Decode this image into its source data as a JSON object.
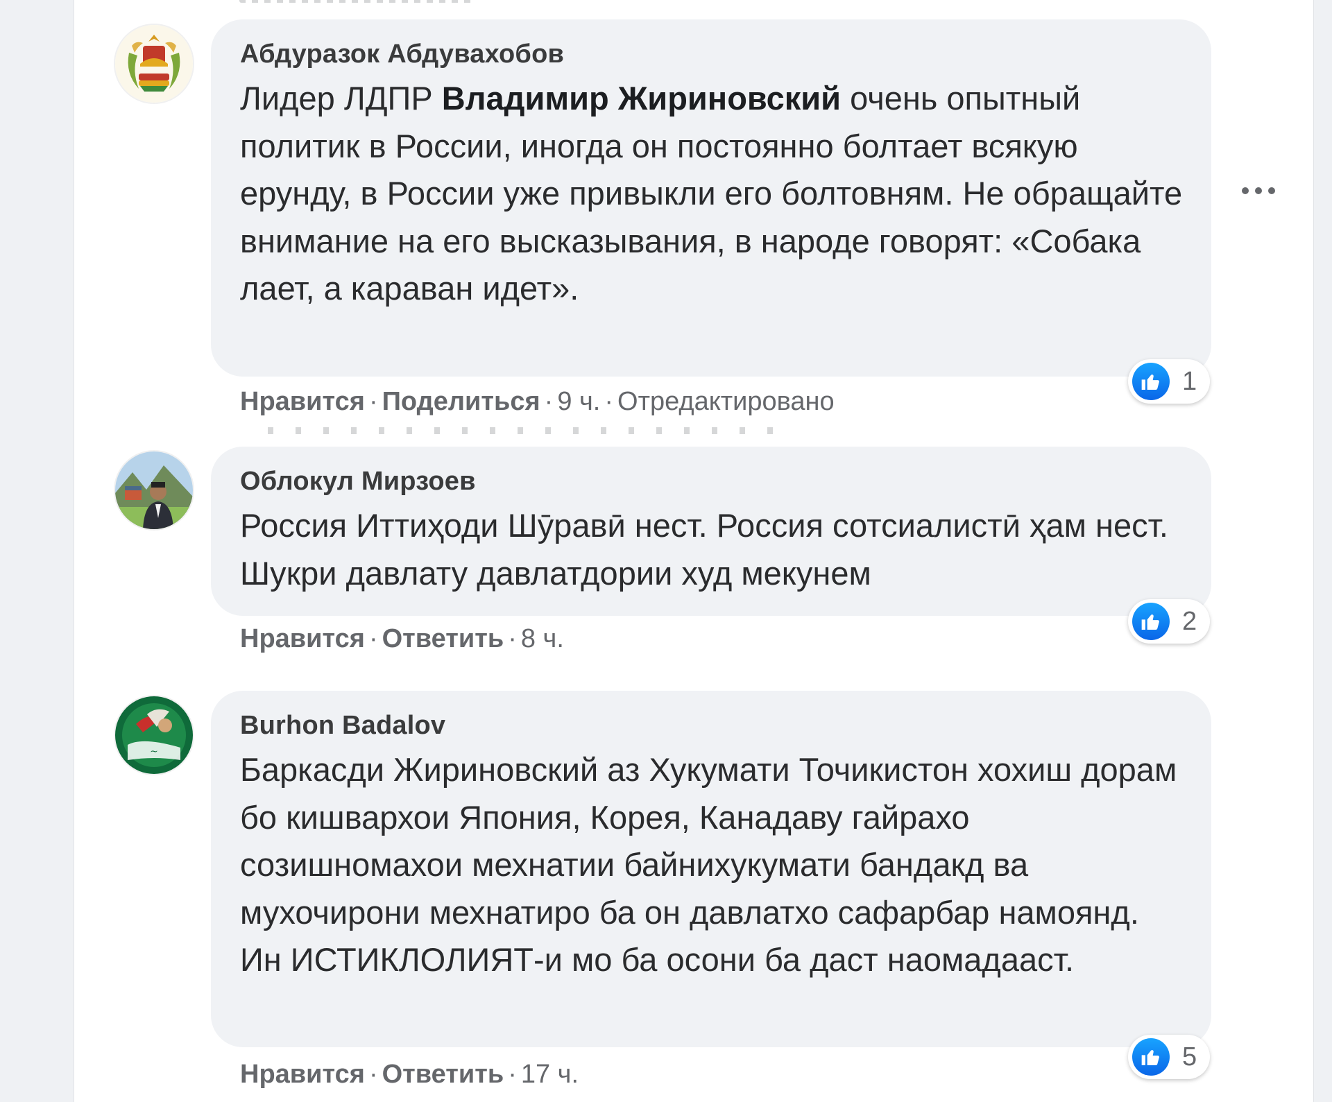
{
  "comments": [
    {
      "author": "Абдуразок Абдувахобов",
      "avatar_icon": "tajik-emblem-avatar",
      "text_parts": [
        "Лидер ЛДПР ",
        "Владимир Жириновский",
        " очень опытный политик в России, иногда он постоянно болтает всякую ерунду, в России уже привыкли его болтовням. Не обращайте внимание на его высказывания, в народе говорят: «Собака лает, а караван идет»."
      ],
      "reactions": {
        "icon": "like-icon",
        "count": "1"
      },
      "actions": {
        "like": "Нравится",
        "second": "Поделиться",
        "time": "9 ч.",
        "edited": "Отредактировано"
      }
    },
    {
      "author": "Облокул Мирзоев",
      "avatar_icon": "person-photo-avatar",
      "text": "Россия Иттиҳоди Шӯравӣ нест. Россия сотсиалистӣ ҳам нест. Шукри давлату давлатдории худ мекунем",
      "reactions": {
        "icon": "like-icon",
        "count": "2"
      },
      "actions": {
        "like": "Нравится",
        "second": "Ответить",
        "time": "8 ч."
      }
    },
    {
      "author": "Burhon Badalov",
      "avatar_icon": "green-logo-avatar",
      "text": "Баркасди Жириновский аз Хукумати Точикистон хохиш дорам бо кишвархои Япония, Корея, Канадаву гайрахо созишномахои мехнатии байнихукумати бандакд ва мухочирони мехнатиро ба он давлатхо сафарбар намоянд.",
      "text2": "Ин ИСТИКЛОЛИЯТ-и мо ба осони ба даст наомадааст.",
      "reactions": {
        "icon": "like-icon",
        "count": "5"
      },
      "actions": {
        "like": "Нравится",
        "second": "Ответить",
        "time": "17 ч."
      }
    }
  ],
  "colors": {
    "bubble": "#f0f2f5",
    "like_blue": "#0a66e8",
    "meta_gray": "#65676b"
  }
}
